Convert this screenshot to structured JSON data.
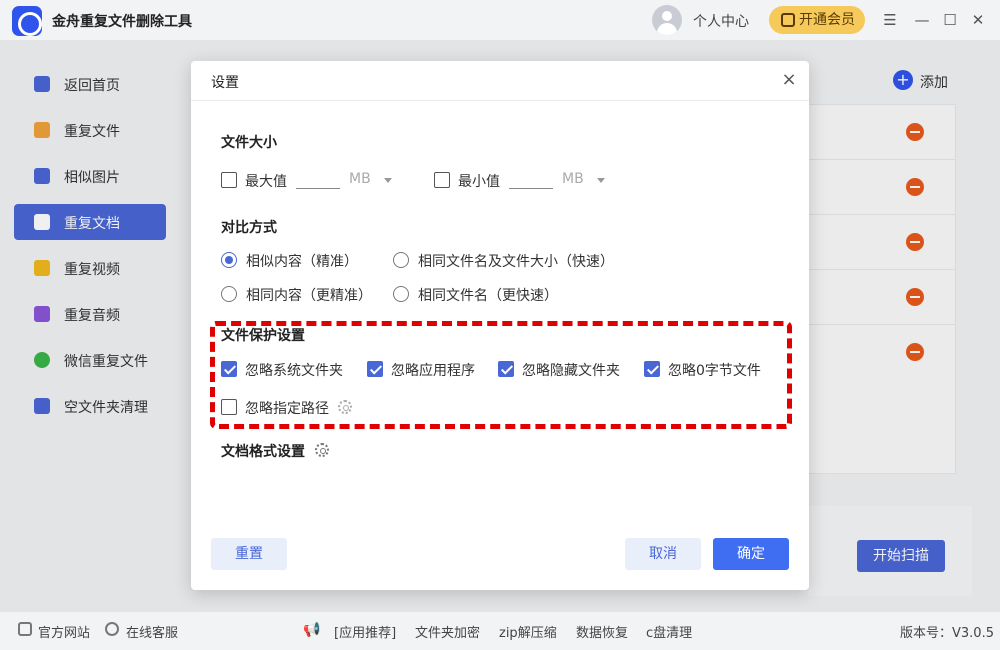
{
  "app": {
    "title": "金舟重复文件删除工具",
    "user_center": "个人中心",
    "vip_label": "开通会员"
  },
  "window_controls": {
    "menu": "☰",
    "minimize": "—",
    "maximize": "☐",
    "close": "✕"
  },
  "sidebar": {
    "items": [
      {
        "label": "返回首页",
        "icon": "home-icon",
        "color": "#4a67d6"
      },
      {
        "label": "重复文件",
        "icon": "folder-icon",
        "color": "#f0a23b"
      },
      {
        "label": "相似图片",
        "icon": "image-icon",
        "color": "#4a67d6"
      },
      {
        "label": "重复文档",
        "icon": "document-icon",
        "color": "#ffffff",
        "active": true
      },
      {
        "label": "重复视频",
        "icon": "video-icon",
        "color": "#f2b91e"
      },
      {
        "label": "重复音频",
        "icon": "audio-icon",
        "color": "#8a57d9"
      },
      {
        "label": "微信重复文件",
        "icon": "wechat-icon",
        "color": "#3bb54a"
      },
      {
        "label": "空文件夹清理",
        "icon": "empty-folder-icon",
        "color": "#4a67d6"
      }
    ]
  },
  "main": {
    "add_label": "添加",
    "start_scan": "开始扫描"
  },
  "dialog": {
    "title": "设置",
    "close": "×",
    "file_size": {
      "title": "文件大小",
      "max_label": "最大值",
      "max_value": "",
      "max_unit": "MB",
      "min_label": "最小值",
      "min_value": "",
      "min_unit": "MB"
    },
    "compare": {
      "title": "对比方式",
      "options": [
        {
          "label": "相似内容（精准）",
          "checked": true
        },
        {
          "label": "相同文件名及文件大小（快速）",
          "checked": false
        },
        {
          "label": "相同内容（更精准）",
          "checked": false
        },
        {
          "label": "相同文件名（更快速）",
          "checked": false
        }
      ]
    },
    "protection": {
      "title": "文件保护设置",
      "options": [
        {
          "label": "忽略系统文件夹",
          "checked": true
        },
        {
          "label": "忽略应用程序",
          "checked": true
        },
        {
          "label": "忽略隐藏文件夹",
          "checked": true
        },
        {
          "label": "忽略0字节文件",
          "checked": true
        },
        {
          "label": "忽略指定路径",
          "checked": false
        }
      ]
    },
    "doc_format": {
      "title": "文档格式设置"
    },
    "reset": "重置",
    "cancel": "取消",
    "confirm": "确定"
  },
  "footer": {
    "official_site": "官方网站",
    "online_service": "在线客服",
    "app_recommend": "[应用推荐]",
    "folder_encrypt": "文件夹加密",
    "zip": "zip解压缩",
    "data_recovery": "数据恢复",
    "c_clean": "c盘清理",
    "version": "版本号：V3.0.5"
  }
}
